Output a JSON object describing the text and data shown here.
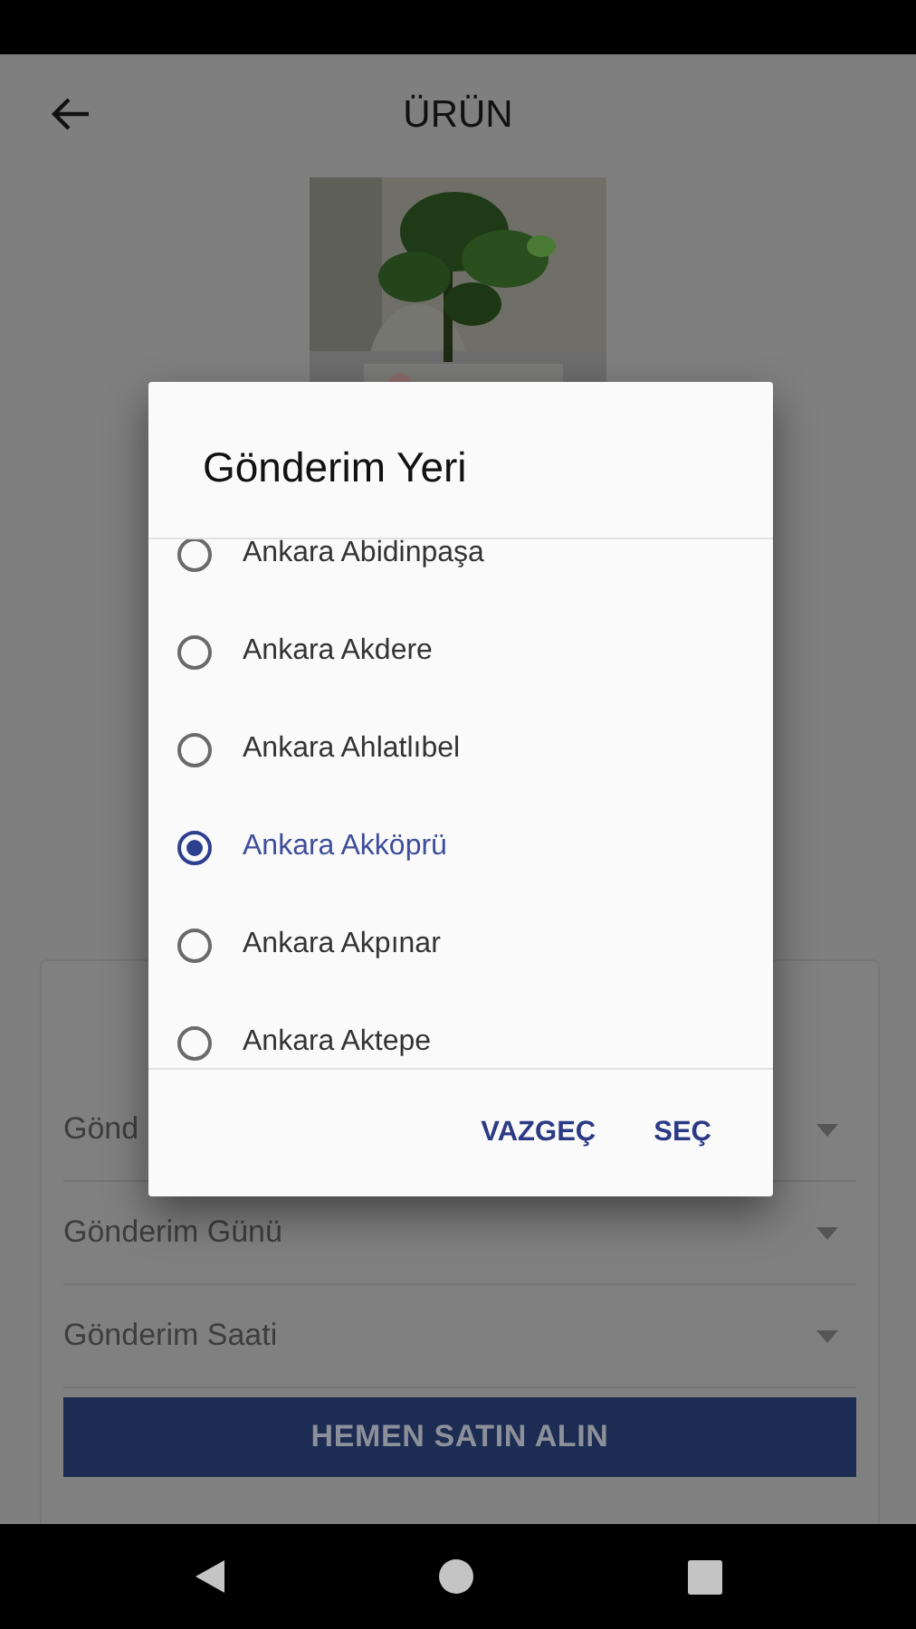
{
  "header": {
    "title": "ÜRÜN"
  },
  "form": {
    "fields": [
      {
        "label": "Gönd"
      },
      {
        "label": "Gönderim Günü"
      },
      {
        "label": "Gönderim Saati"
      }
    ],
    "buy_button": "HEMEN SATIN ALIN"
  },
  "dialog": {
    "title": "Gönderim Yeri",
    "options": [
      {
        "label": "Ankara Abidinpaşa",
        "selected": false
      },
      {
        "label": "Ankara Akdere",
        "selected": false
      },
      {
        "label": "Ankara Ahlatlıbel",
        "selected": false
      },
      {
        "label": "Ankara Akköprü",
        "selected": true
      },
      {
        "label": "Ankara Akpınar",
        "selected": false
      },
      {
        "label": "Ankara Aktepe",
        "selected": false
      }
    ],
    "buttons": [
      "VAZGEÇ",
      "SEÇ"
    ]
  }
}
